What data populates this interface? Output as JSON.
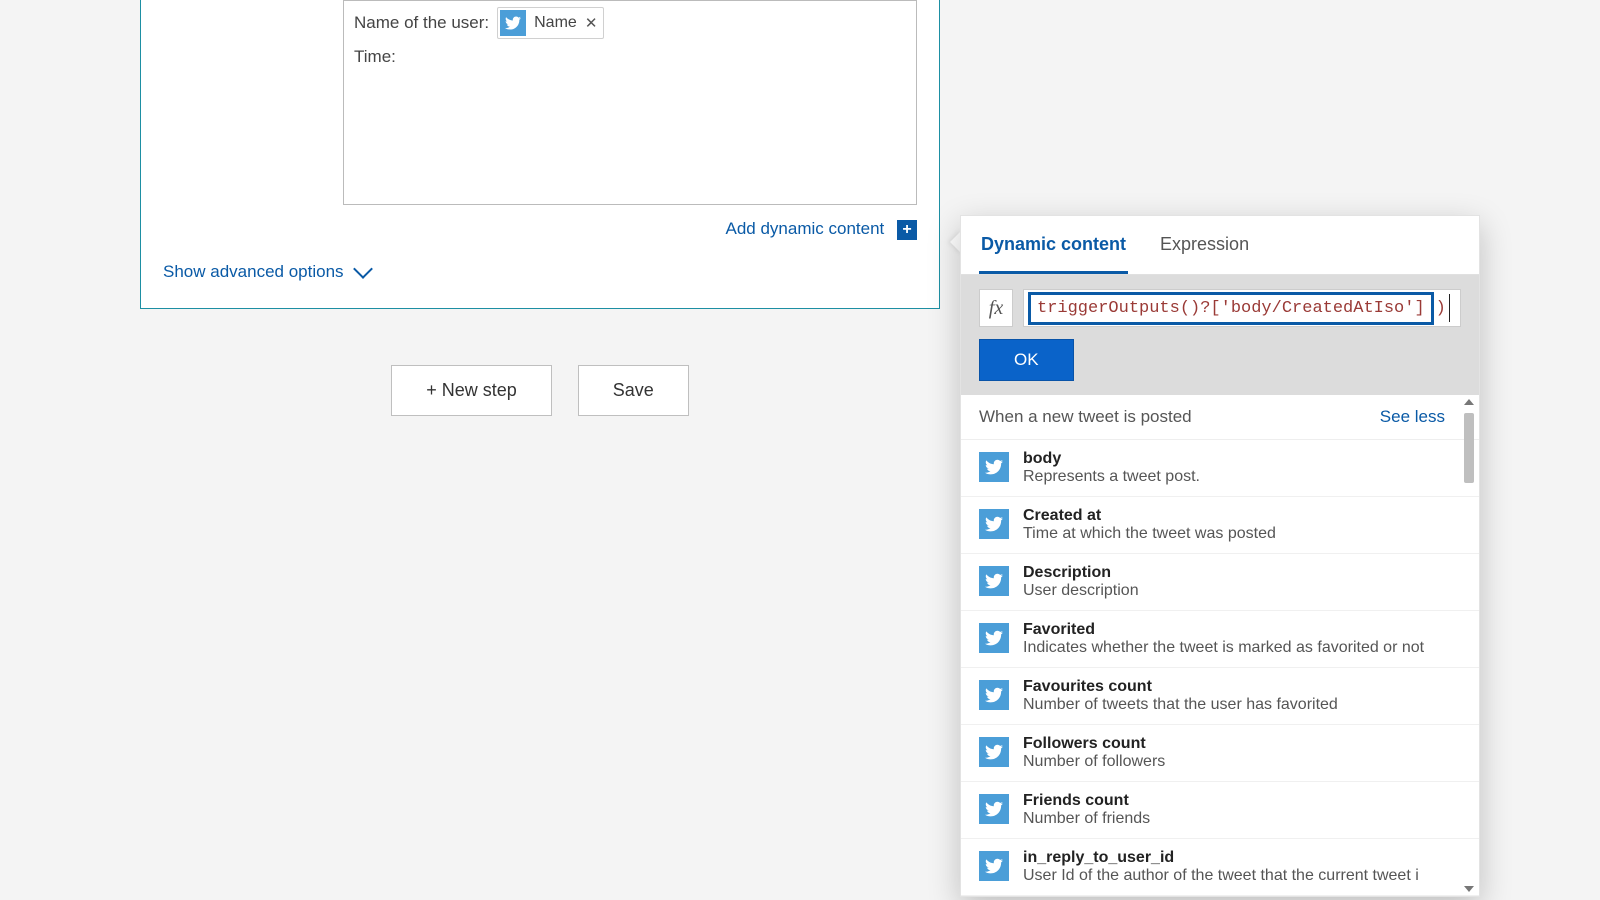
{
  "card": {
    "input_lines": {
      "name_label": "Name of the user:",
      "time_label": "Time:",
      "token_label": "Name"
    },
    "add_dynamic": "Add dynamic content",
    "advanced": "Show advanced options"
  },
  "buttons": {
    "new_step": "+ New step",
    "save": "Save"
  },
  "picker": {
    "tabs": {
      "dynamic": "Dynamic content",
      "expression": "Expression"
    },
    "fx_label": "fx",
    "expression_value": "triggerOutputs()?['body/CreatedAtIso']",
    "expression_trail": ")",
    "ok": "OK",
    "group_title": "When a new tweet is posted",
    "see_less": "See less",
    "items": [
      {
        "name": "body",
        "desc": "Represents a tweet post."
      },
      {
        "name": "Created at",
        "desc": "Time at which the tweet was posted"
      },
      {
        "name": "Description",
        "desc": "User description"
      },
      {
        "name": "Favorited",
        "desc": "Indicates whether the tweet is marked as favorited or not"
      },
      {
        "name": "Favourites count",
        "desc": "Number of tweets that the user has favorited"
      },
      {
        "name": "Followers count",
        "desc": "Number of followers"
      },
      {
        "name": "Friends count",
        "desc": "Number of friends"
      },
      {
        "name": "in_reply_to_user_id",
        "desc": "User Id of the author of the tweet that the current tweet i"
      }
    ]
  }
}
